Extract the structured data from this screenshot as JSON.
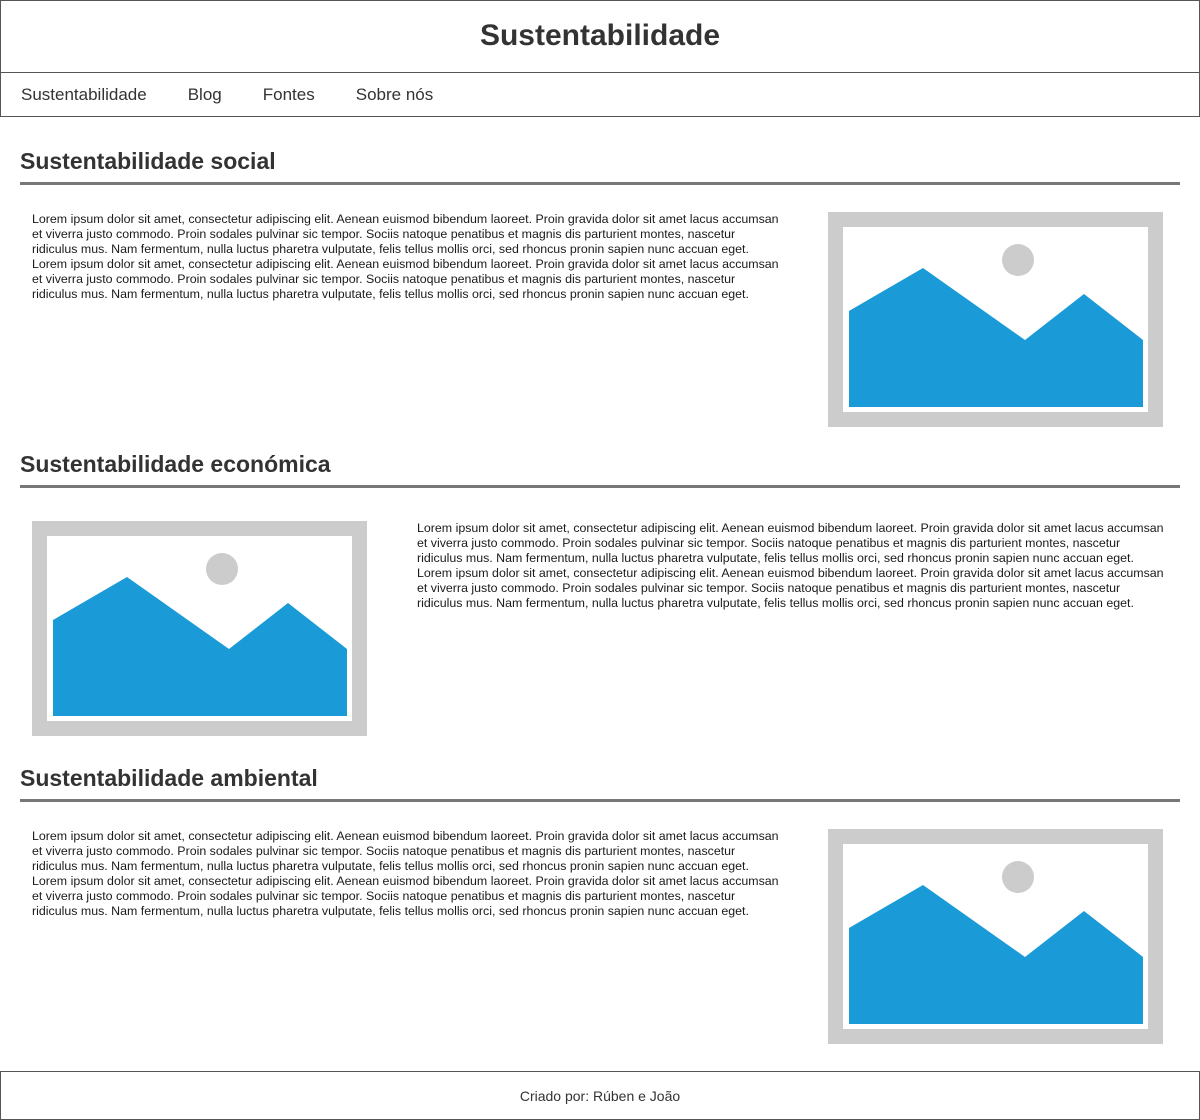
{
  "header": {
    "title": "Sustentabilidade"
  },
  "nav": {
    "items": [
      "Sustentabilidade",
      "Blog",
      "Fontes",
      "Sobre nós"
    ]
  },
  "sections": [
    {
      "title": "Sustentabilidade social",
      "text": "Lorem ipsum dolor sit amet, consectetur adipiscing elit. Aenean euismod bibendum laoreet. Proin gravida dolor sit amet lacus accumsan et viverra justo commodo. Proin sodales pulvinar sic tempor. Sociis natoque penatibus et magnis dis parturient montes, nascetur ridiculus mus. Nam fermentum, nulla luctus pharetra vulputate, felis tellus mollis orci, sed rhoncus pronin sapien nunc accuan eget. Lorem ipsum dolor sit amet, consectetur adipiscing elit. Aenean euismod bibendum laoreet. Proin gravida dolor sit amet lacus accumsan et viverra justo commodo. Proin sodales pulvinar sic tempor. Sociis natoque penatibus et magnis dis parturient montes, nascetur ridiculus mus. Nam fermentum, nulla luctus pharetra vulputate, felis tellus mollis orci, sed rhoncus pronin sapien nunc accuan eget.",
      "image_icon": "image-placeholder-icon"
    },
    {
      "title": "Sustentabilidade económica",
      "text": "Lorem ipsum dolor sit amet, consectetur adipiscing elit. Aenean euismod bibendum laoreet. Proin gravida dolor sit amet lacus accumsan et viverra justo commodo. Proin sodales pulvinar sic tempor. Sociis natoque penatibus et magnis dis parturient montes, nascetur ridiculus mus. Nam fermentum, nulla luctus pharetra vulputate, felis tellus mollis orci, sed rhoncus pronin sapien nunc accuan eget. Lorem ipsum dolor sit amet, consectetur adipiscing elit. Aenean euismod bibendum laoreet. Proin gravida dolor sit amet lacus accumsan et viverra justo commodo. Proin sodales pulvinar sic tempor. Sociis natoque penatibus et magnis dis parturient montes, nascetur ridiculus mus. Nam fermentum, nulla luctus pharetra vulputate, felis tellus mollis orci, sed rhoncus pronin sapien nunc accuan eget.",
      "image_icon": "image-placeholder-icon"
    },
    {
      "title": "Sustentabilidade ambiental",
      "text": "Lorem ipsum dolor sit amet, consectetur adipiscing elit. Aenean euismod bibendum laoreet. Proin gravida dolor sit amet lacus accumsan et viverra justo commodo. Proin sodales pulvinar sic tempor. Sociis natoque penatibus et magnis dis parturient montes, nascetur ridiculus mus. Nam fermentum, nulla luctus pharetra vulputate, felis tellus mollis orci, sed rhoncus pronin sapien nunc accuan eget. Lorem ipsum dolor sit amet, consectetur adipiscing elit. Aenean euismod bibendum laoreet. Proin gravida dolor sit amet lacus accumsan et viverra justo commodo. Proin sodales pulvinar sic tempor. Sociis natoque penatibus et magnis dis parturient montes, nascetur ridiculus mus. Nam fermentum, nulla luctus pharetra vulputate, felis tellus mollis orci, sed rhoncus pronin sapien nunc accuan eget.",
      "image_icon": "image-placeholder-icon"
    }
  ],
  "footer": {
    "text": "Criado por: Rúben e João"
  },
  "colors": {
    "placeholder_frame": "#cccccc",
    "placeholder_mountain": "#1a9bd7",
    "rule": "#777777",
    "text": "#333333"
  }
}
